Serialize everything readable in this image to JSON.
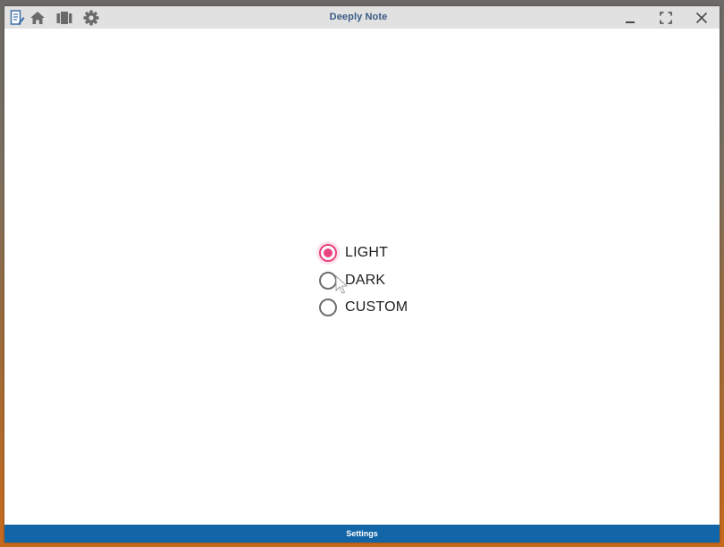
{
  "window": {
    "title": "Deeply Note"
  },
  "toolbar": {
    "icons": [
      "note-icon",
      "home-icon",
      "notebooks-icon",
      "gear-icon"
    ]
  },
  "window_controls": [
    "minimize-icon",
    "maximize-icon",
    "close-icon"
  ],
  "theme_options": {
    "selected": "LIGHT",
    "items": [
      {
        "label": "LIGHT",
        "checked": true
      },
      {
        "label": "DARK",
        "checked": false
      },
      {
        "label": "CUSTOM",
        "checked": false
      }
    ]
  },
  "statusbar": {
    "label": "Settings"
  },
  "colors": {
    "accent": "#e9427e",
    "statusbar": "#1266a8",
    "titlebar": "#e1e1e1",
    "title_text": "#3a5a86"
  }
}
